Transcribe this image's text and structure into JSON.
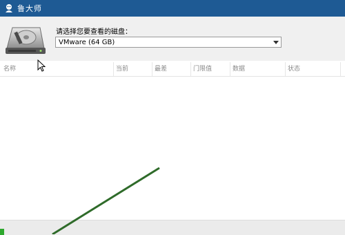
{
  "window": {
    "title": "鲁大师"
  },
  "disk_selector": {
    "prompt": "请选择您要查看的磁盘：",
    "selected": "VMware  (64 GB)"
  },
  "table": {
    "columns": [
      "名称",
      "当前",
      "最差",
      "门限值",
      "数据",
      "状态"
    ],
    "rows": []
  },
  "status": {
    "progress_fraction": 0.012
  },
  "icons": {
    "app": "ludashi-app-icon",
    "disk": "hard-disk-icon",
    "dropdown": "chevron-down-icon",
    "cursor": "mouse-cursor-icon"
  },
  "colors": {
    "titlebar": "#1e5a94",
    "progress": "#2ea82e",
    "annotation_line": "#2f6b2a"
  }
}
